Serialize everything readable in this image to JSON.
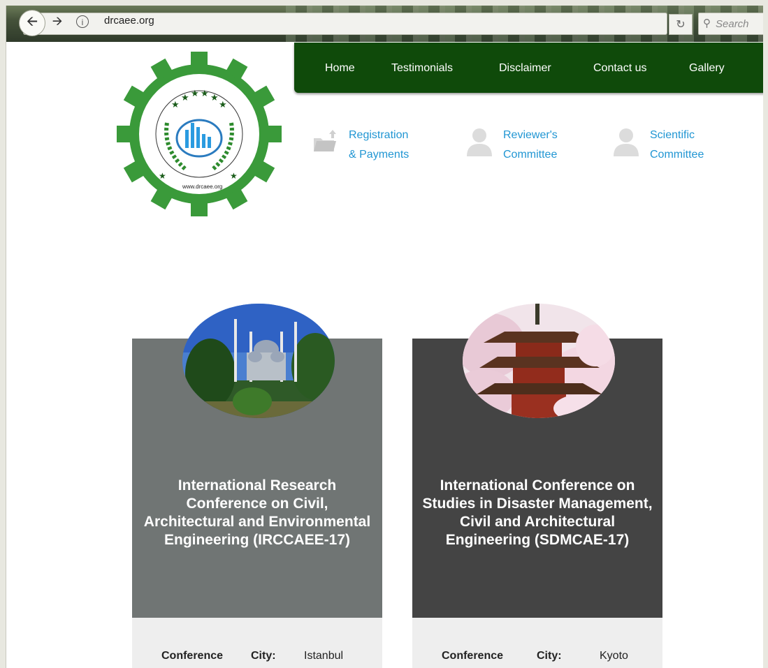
{
  "browser": {
    "url": "drcaee.org",
    "search_placeholder": "Search"
  },
  "nav": {
    "items": [
      "Home",
      "Testimonials",
      "Disclaimer",
      "Contact us",
      "Gallery"
    ]
  },
  "logo": {
    "ring_text": "Dignified Researchers in Civil, Architectural and Environmental Engineering",
    "url_text": "www.drcaee.org"
  },
  "quick_links": [
    {
      "line1": "Registration",
      "line2": "& Payments",
      "icon": "folder-upload-icon"
    },
    {
      "line1": "Reviewer's",
      "line2": "Committee",
      "icon": "person-icon"
    },
    {
      "line1": "Scientific",
      "line2": "Committee",
      "icon": "person-icon"
    }
  ],
  "cards": [
    {
      "title": "International Research Conference on Civil, Architectural and Environmental Engineering (IRCCAEE-17)",
      "image": "mosque-photo",
      "label_conference": "Conference",
      "label_city": "City:",
      "city": "Istanbul",
      "color": "#707574"
    },
    {
      "title": "International Conference on Studies in Disaster Management, Civil and Architectural Engineering (SDMCAE-17)",
      "image": "pagoda-photo",
      "label_conference": "Conference",
      "label_city": "City:",
      "city": "Kyoto",
      "color": "#444444"
    }
  ],
  "colors": {
    "nav_bg": "#0f4a0a",
    "link_blue": "#2196d3",
    "logo_green": "#3a9a3a"
  }
}
